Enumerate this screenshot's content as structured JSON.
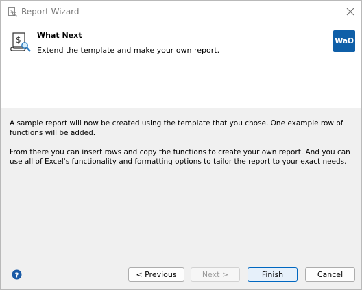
{
  "window": {
    "title": "Report Wizard"
  },
  "header": {
    "heading": "What Next",
    "subheading": "Extend the template and make your own report.",
    "logo_text": "WaO"
  },
  "body": {
    "paragraph1": "A sample report will now be created using the template that you chose. One example row of functions will be added.",
    "paragraph2": "From there you can insert rows and copy the functions to create your own report. And you can use all of Excel's functionality and formatting options to tailor the report to your exact needs."
  },
  "footer": {
    "previous_label": "< Previous",
    "next_label": "Next >",
    "finish_label": "Finish",
    "cancel_label": "Cancel"
  },
  "colors": {
    "accent": "#0067c0",
    "logo": "#0f5fa8",
    "help_icon": "#1a5aa6"
  }
}
